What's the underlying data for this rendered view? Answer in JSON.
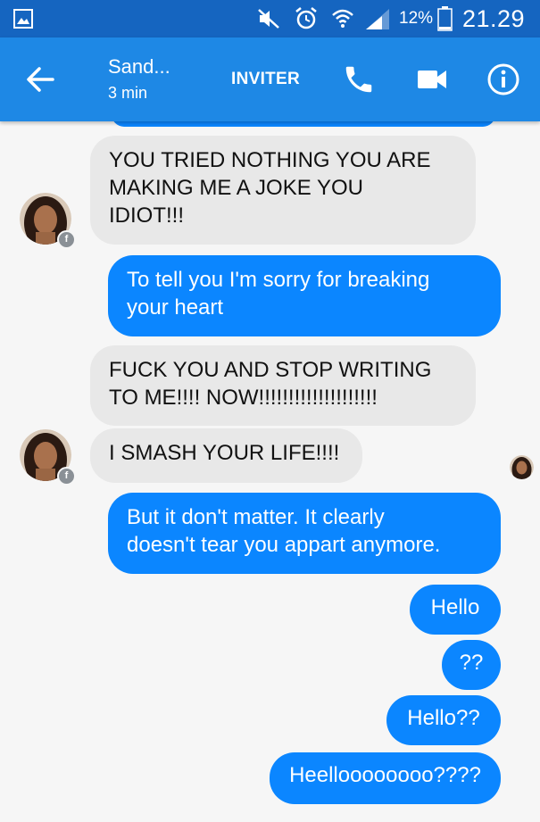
{
  "status_bar": {
    "battery": "12%",
    "time": "21.29",
    "icons": [
      "gallery-icon",
      "mute-icon",
      "alarm-icon",
      "wifi-icon",
      "signal-icon",
      "battery-icon"
    ]
  },
  "header": {
    "contact_name": "Sand...",
    "last_active": "3 min",
    "invite_label": "INVITER",
    "icons": [
      "back-arrow-icon",
      "phone-icon",
      "video-camera-icon",
      "info-icon"
    ]
  },
  "messages": [
    {
      "sender": "contact",
      "lines": [
        "YOU TRIED NOTHING YOU ARE",
        "MAKING ME A JOKE YOU",
        "IDIOT!!!"
      ]
    },
    {
      "sender": "me",
      "lines": [
        "To tell you I'm sorry for breaking",
        "your heart"
      ]
    },
    {
      "sender": "contact",
      "lines": [
        "FUCK YOU AND STOP WRITING",
        "TO ME!!!! NOW!!!!!!!!!!!!!!!!!!!!"
      ]
    },
    {
      "sender": "contact",
      "lines": [
        "I SMASH YOUR LIFE!!!!"
      ]
    },
    {
      "sender": "me",
      "lines": [
        "But it don't matter. It clearly",
        "doesn't tear you appart anymore."
      ]
    },
    {
      "sender": "me",
      "lines": [
        "Hello"
      ]
    },
    {
      "sender": "me",
      "lines": [
        "??"
      ]
    },
    {
      "sender": "me",
      "lines": [
        "Hello??"
      ]
    },
    {
      "sender": "me",
      "lines": [
        "Heelloooooooo????"
      ]
    }
  ],
  "colors": {
    "status_bar": "#1565c0",
    "app_bar": "#1e88e5",
    "outgoing_bubble": "#0b86ff",
    "incoming_bubble": "#e8e8e8",
    "background": "#f6f6f6"
  }
}
